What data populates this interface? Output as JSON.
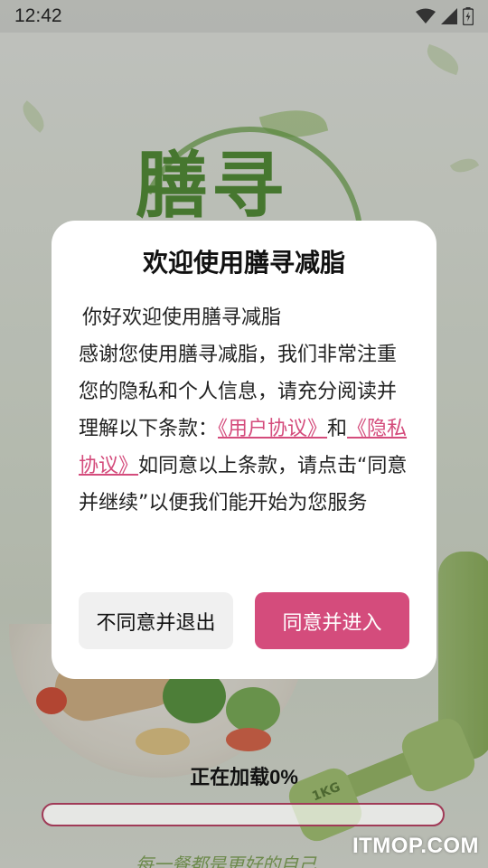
{
  "status_bar": {
    "time": "12:42",
    "icons": [
      "wifi-icon",
      "signal-icon",
      "battery-icon"
    ]
  },
  "background": {
    "logo_text": "膳寻",
    "weight_label": "1KG",
    "slogan": "每一餐都是更好的自己"
  },
  "dialog": {
    "title": "欢迎使用膳寻减脂",
    "greeting": "你好欢迎使用膳寻减脂",
    "body_intro": "感谢您使用膳寻减脂，我们非常注重您的隐私和个人信息，请充分阅读并理解以下条款：",
    "user_agreement_link": "《用户协议》",
    "conjunction": "和",
    "privacy_policy_link": "《隐私协议》",
    "body_outro": "如同意以上条款，请点击“同意并继续”以便我们能开始为您服务",
    "disagree_button": "不同意并退出",
    "agree_button": "同意并进入"
  },
  "loading": {
    "label": "正在加载0%",
    "progress_percent": 0
  },
  "watermark": "ITMOP.COM",
  "colors": {
    "accent": "#d44c7c",
    "progress_border": "#a03a57",
    "brand_green": "#56923a"
  }
}
